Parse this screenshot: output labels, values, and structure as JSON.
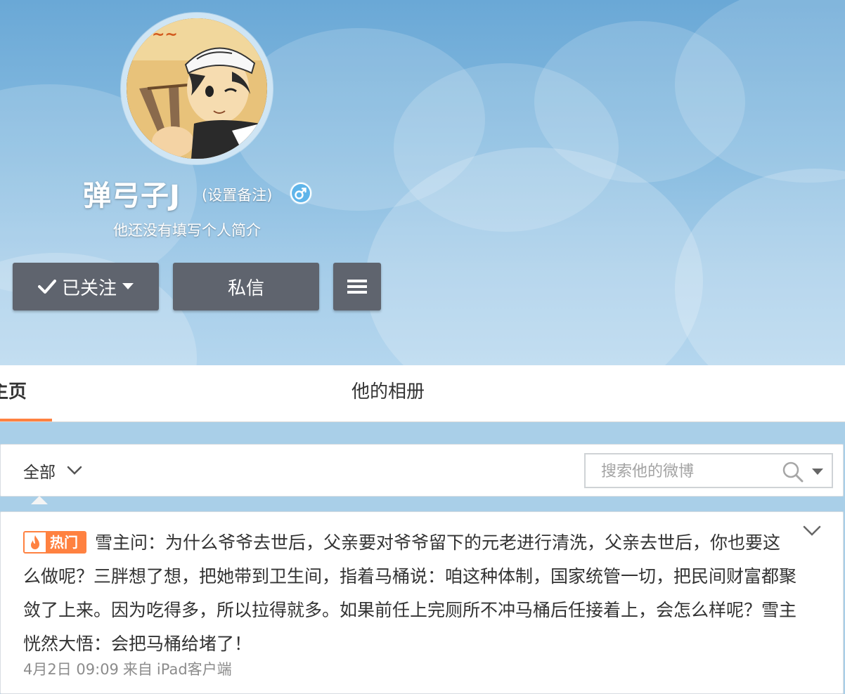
{
  "profile": {
    "name": "弹弓子J",
    "remark_link": "(设置备注)",
    "gender": "male",
    "bio": "他还没有填写个人简介"
  },
  "actions": {
    "follow_label": "已关注",
    "message_label": "私信",
    "more_icon": "menu-icon"
  },
  "tabs": [
    {
      "label": "主页",
      "active": true
    },
    {
      "label": "他的相册",
      "active": false
    }
  ],
  "filter": {
    "current": "全部",
    "search_placeholder": "搜索他的微博"
  },
  "post": {
    "badge": "热门",
    "text": "雪主问：为什么爷爷去世后，父亲要对爷爷留下的元老进行清洗，父亲去世后，你也要这么做呢？三胖想了想，把她带到卫生间，指着马桶说：咱这种体制，国家统管一切，把民间财富都聚敛了上来。因为吃得多，所以拉得就多。如果前任上完厕所不冲马桶后任接着上，会怎么样呢？雪主恍然大悟：会把马桶给堵了！",
    "date": "4月2日 09:09",
    "from_label": "来自",
    "source": "iPad客户端"
  },
  "colors": {
    "accent": "#ff8140",
    "button_bg": "#5f646e",
    "sky": "#86bbe0"
  }
}
